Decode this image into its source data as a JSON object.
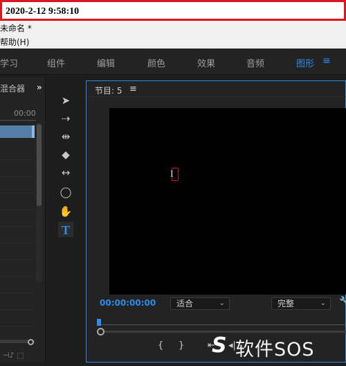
{
  "timestamp": "2020-2-12 9:58:10",
  "titlebar": {
    "title": "未命名 *",
    "menu_help": "帮助(H)"
  },
  "workspaces": {
    "items": [
      "学习",
      "组件",
      "编辑",
      "颜色",
      "效果",
      "音频",
      "图形"
    ],
    "active": "图形",
    "menu_icon": "hamburger-menu-icon"
  },
  "project_panel": {
    "title": "混合器",
    "timecode": "00:00"
  },
  "tools": [
    "selection-tool-icon",
    "track-select-tool-icon",
    "ripple-edit-tool-icon",
    "razor-tool-icon",
    "slip-tool-icon",
    "ellipse-tool-icon",
    "hand-tool-icon",
    "type-tool-icon"
  ],
  "type_tool_label": "T",
  "monitor": {
    "title": "节目: 5",
    "timecode": "00:00:00:00",
    "fit_select": "适合",
    "quality_select": "完整"
  },
  "watermark": {
    "text": "软件SOS"
  },
  "colors": {
    "accent": "#2d8ceb",
    "panel": "#232323",
    "stamp_border": "#e0141e"
  }
}
